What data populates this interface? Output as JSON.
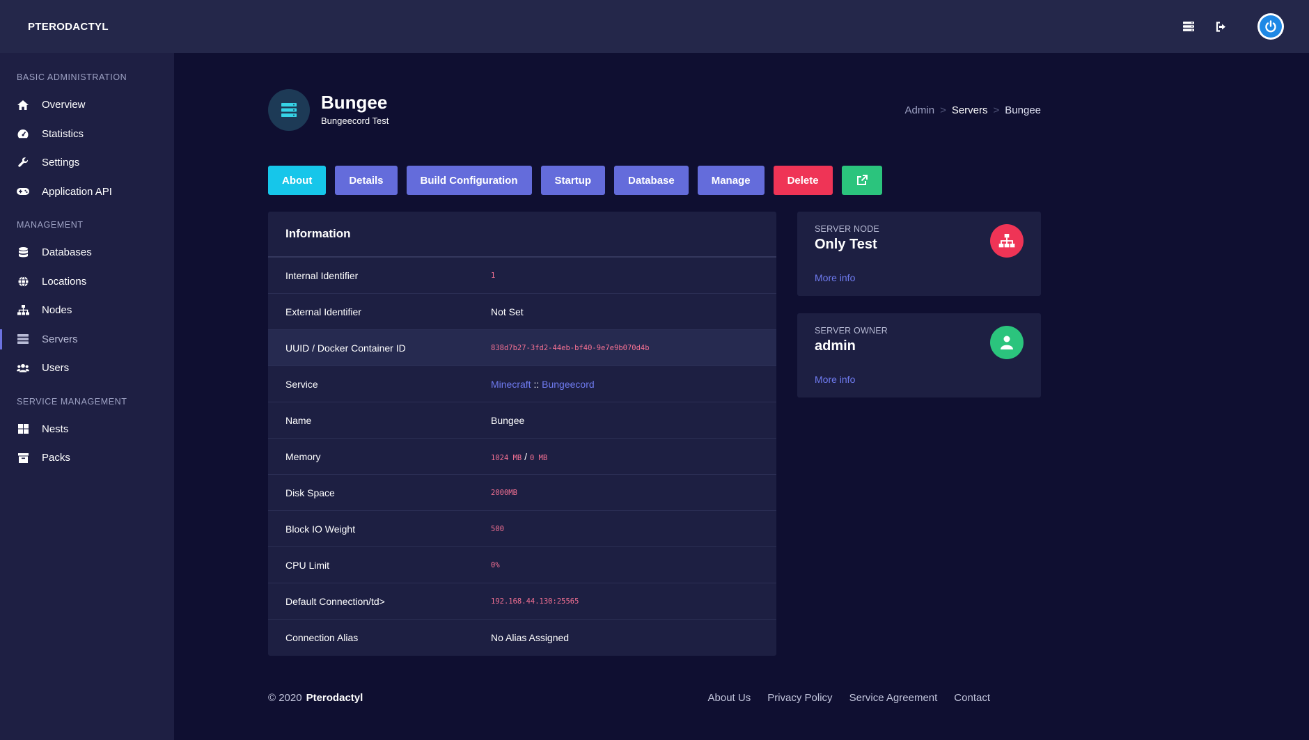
{
  "topbar": {
    "brand": "PTERODACTYL",
    "icons": [
      "server-list-icon",
      "logout-icon",
      "power-icon"
    ]
  },
  "sidebar": {
    "sections": [
      {
        "heading": "BASIC ADMINISTRATION",
        "items": [
          {
            "label": "Overview",
            "icon": "home-icon"
          },
          {
            "label": "Statistics",
            "icon": "gauge-icon"
          },
          {
            "label": "Settings",
            "icon": "wrench-icon"
          },
          {
            "label": "Application API",
            "icon": "gamepad-icon"
          }
        ]
      },
      {
        "heading": "MANAGEMENT",
        "items": [
          {
            "label": "Databases",
            "icon": "database-icon"
          },
          {
            "label": "Locations",
            "icon": "globe-icon"
          },
          {
            "label": "Nodes",
            "icon": "sitemap-icon"
          },
          {
            "label": "Servers",
            "icon": "server-icon",
            "active": true
          },
          {
            "label": "Users",
            "icon": "users-icon"
          }
        ]
      },
      {
        "heading": "SERVICE MANAGEMENT",
        "items": [
          {
            "label": "Nests",
            "icon": "grid-icon"
          },
          {
            "label": "Packs",
            "icon": "archive-icon"
          }
        ]
      }
    ]
  },
  "header": {
    "title": "Bungee",
    "subtitle": "Bungeecord Test",
    "breadcrumb": [
      "Admin",
      "Servers",
      "Bungee"
    ],
    "breadcrumb_sep": ">"
  },
  "tabs": [
    "About",
    "Details",
    "Build Configuration",
    "Startup",
    "Database",
    "Manage",
    "Delete"
  ],
  "information": {
    "title": "Information",
    "rows": {
      "internal_id": {
        "label": "Internal Identifier",
        "value": "1"
      },
      "external_id": {
        "label": "External Identifier",
        "value": "Not Set"
      },
      "uuid": {
        "label": "UUID / Docker Container ID",
        "value": "838d7b27-3fd2-44eb-bf40-9e7e9b070d4b"
      },
      "service": {
        "label": "Service",
        "nest": "Minecraft",
        "sep": "::",
        "egg": "Bungeecord"
      },
      "name": {
        "label": "Name",
        "value": "Bungee"
      },
      "memory": {
        "label": "Memory",
        "value": "1024 MB",
        "sep": "/",
        "swap": "0 MB"
      },
      "disk": {
        "label": "Disk Space",
        "value": "2000MB"
      },
      "io": {
        "label": "Block IO Weight",
        "value": "500"
      },
      "cpu": {
        "label": "CPU Limit",
        "value": "0%"
      },
      "connection": {
        "label": "Default Connection/td>",
        "value": "192.168.44.130:25565"
      },
      "alias": {
        "label": "Connection Alias",
        "value": "No Alias Assigned"
      }
    }
  },
  "cards": {
    "node": {
      "label": "SERVER NODE",
      "value": "Only Test",
      "more": "More info",
      "icon": "sitemap-icon",
      "color": "#ef3456"
    },
    "owner": {
      "label": "SERVER OWNER",
      "value": "admin",
      "more": "More info",
      "icon": "user-icon",
      "color": "#2bc47d"
    }
  },
  "footer": {
    "copyright": "© 2020",
    "brand": "Pterodactyl",
    "links": [
      "About Us",
      "Privacy Policy",
      "Service Agreement",
      "Contact"
    ]
  }
}
